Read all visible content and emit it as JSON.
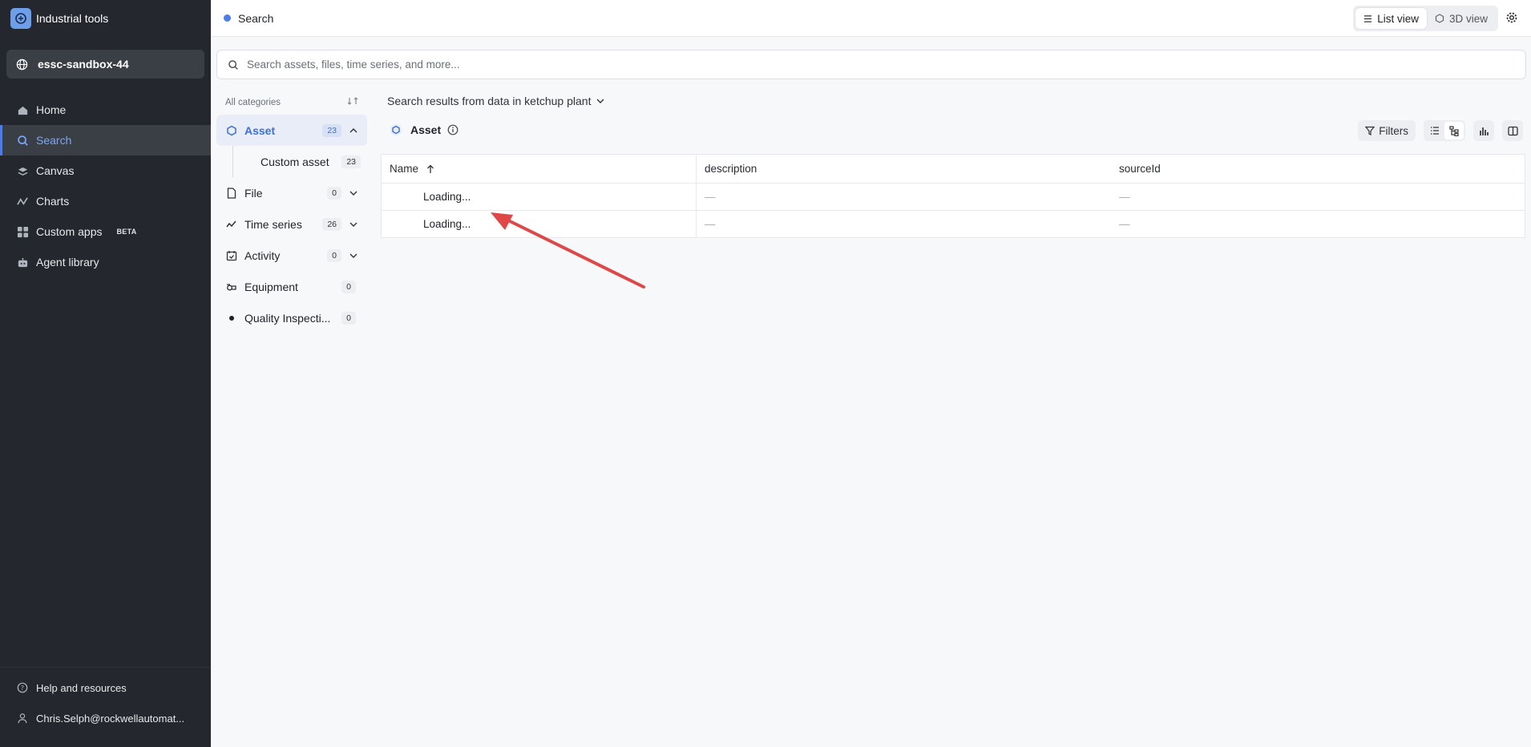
{
  "app": {
    "title": "Industrial tools"
  },
  "project": {
    "name": "essc-sandbox-44"
  },
  "nav": {
    "items": [
      {
        "label": "Home",
        "icon": "home-icon"
      },
      {
        "label": "Search",
        "icon": "search-icon",
        "active": true
      },
      {
        "label": "Canvas",
        "icon": "canvas-icon"
      },
      {
        "label": "Charts",
        "icon": "charts-icon"
      },
      {
        "label": "Custom apps",
        "icon": "apps-icon",
        "badge": "BETA"
      },
      {
        "label": "Agent library",
        "icon": "robot-icon"
      }
    ],
    "bottom": [
      {
        "label": "Help and resources",
        "icon": "help-icon"
      },
      {
        "label": "Chris.Selph@rockwellautomat...",
        "icon": "user-icon"
      }
    ]
  },
  "topbar": {
    "tab_title": "Search",
    "list_view": "List view",
    "view_3d": "3D view"
  },
  "search": {
    "placeholder": "Search assets, files, time series, and more..."
  },
  "categories": {
    "header": "All categories",
    "items": [
      {
        "label": "Asset",
        "count": "23",
        "icon": "asset-icon",
        "selected": true
      },
      {
        "label": "Custom asset",
        "count": "23",
        "sub": true
      },
      {
        "label": "File",
        "count": "0",
        "icon": "file-icon"
      },
      {
        "label": "Time series",
        "count": "26",
        "icon": "timeseries-icon"
      },
      {
        "label": "Activity",
        "count": "0",
        "icon": "activity-icon"
      },
      {
        "label": "Equipment",
        "count": "0",
        "icon": "equipment-icon"
      },
      {
        "label": "Quality Inspecti...",
        "count": "0",
        "icon": "dot-icon"
      }
    ]
  },
  "results": {
    "title": "Search results from data in ketchup plant",
    "section": "Asset",
    "filters": "Filters",
    "columns": [
      "Name",
      "description",
      "sourceId"
    ],
    "rows": [
      [
        "Loading...",
        "—",
        "—"
      ],
      [
        "Loading...",
        "—",
        "—"
      ]
    ]
  },
  "colors": {
    "accent": "#4b7cf0",
    "sidebar": "#24282e",
    "annotation_arrow": "#e04848"
  }
}
